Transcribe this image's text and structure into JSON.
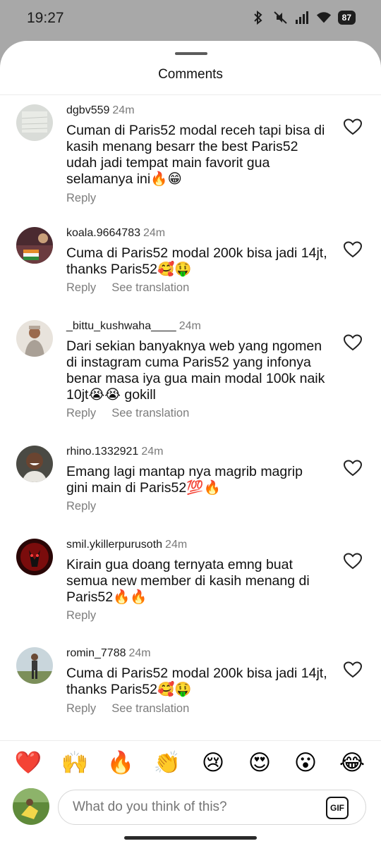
{
  "status_bar": {
    "time": "19:27",
    "battery": "87",
    "icons": [
      "bluetooth-icon",
      "mute-icon",
      "signal-icon",
      "wifi-icon",
      "battery-icon"
    ]
  },
  "sheet": {
    "title": "Comments"
  },
  "comments": [
    {
      "username": "dgbv559",
      "time": "24m",
      "text": "Cuman di Paris52 modal receh tapi bisa di kasih menang besarr the best Paris52 udah jadi tempat main favorit gua selamanya ini🔥😁",
      "reply": "Reply",
      "see_translation": ""
    },
    {
      "username": "koala.9664783",
      "time": "24m",
      "text": "Cuma di Paris52 modal 200k bisa jadi 14jt, thanks Paris52🥰🤑",
      "reply": "Reply",
      "see_translation": "See translation"
    },
    {
      "username": "_bittu_kushwaha____",
      "time": "24m",
      "text": "Dari sekian banyaknya web yang ngomen di instagram cuma Paris52 yang infonya benar masa iya gua main modal 100k naik 10jt😭😭 gokill",
      "reply": "Reply",
      "see_translation": "See translation"
    },
    {
      "username": "rhino.1332921",
      "time": "24m",
      "text": "Emang lagi mantap nya magrib magrip gini main di Paris52💯🔥",
      "reply": "Reply",
      "see_translation": ""
    },
    {
      "username": "smil.ykillerpurusoth",
      "time": "24m",
      "text": "Kirain gua doang ternyata emng buat semua new member di kasih menang di Paris52🔥🔥",
      "reply": "Reply",
      "see_translation": ""
    },
    {
      "username": "romin_7788",
      "time": "24m",
      "text": "Cuma di Paris52 modal 200k bisa jadi 14jt, thanks Paris52🥰🤑",
      "reply": "Reply",
      "see_translation": "See translation"
    }
  ],
  "quick_reactions": [
    "❤️",
    "🙌",
    "🔥",
    "👏",
    "😢",
    "😍",
    "😮",
    "😂"
  ],
  "composer": {
    "placeholder": "What do you think of this?",
    "gif_label": "GIF"
  },
  "colors": {
    "background_overlay": "#a8a8a8",
    "sheet": "#ffffff",
    "secondary_text": "#7d7d7d"
  }
}
